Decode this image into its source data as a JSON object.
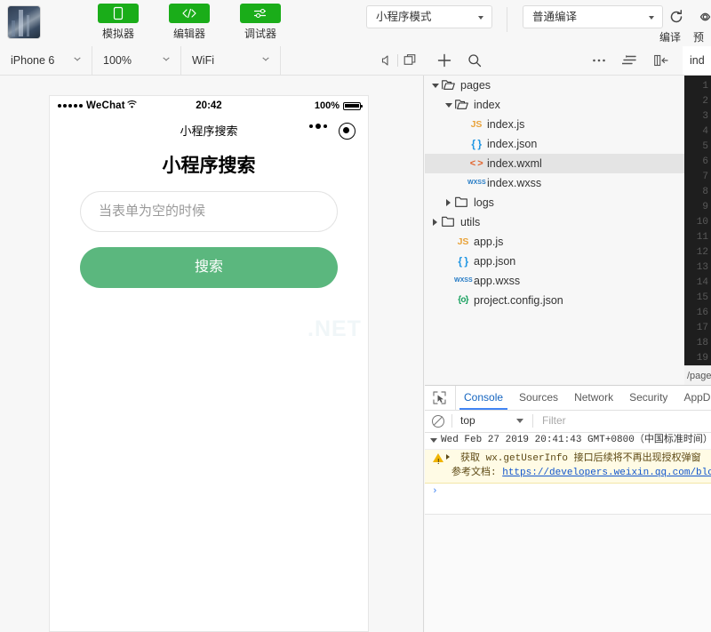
{
  "toolbar": {
    "avatar_name": "user-avatar",
    "mode_buttons": [
      {
        "label": "模拟器",
        "icon": "phone-icon"
      },
      {
        "label": "编辑器",
        "icon": "code-icon"
      },
      {
        "label": "调试器",
        "icon": "debug-icon"
      }
    ],
    "mode_select": {
      "value": "小程序模式"
    },
    "build_select": {
      "value": "普通编译"
    },
    "compile": {
      "label": "编译",
      "icon": "refresh-icon"
    },
    "preview": {
      "label": "预",
      "icon": "eye-icon"
    },
    "accent_green": "#1aad19"
  },
  "subbar": {
    "device": "iPhone 6",
    "zoom": "100%",
    "network": "WiFi",
    "icons": [
      "mute-icon",
      "multi-window-icon",
      "add-icon",
      "search-icon",
      "more-icon",
      "sort-icon",
      "panel-toggle-icon"
    ],
    "file_tab": "ind"
  },
  "simulator": {
    "status_bar": {
      "carrier": "WeChat",
      "time": "20:42",
      "battery_percent": "100%"
    },
    "nav_title": "小程序搜索",
    "page_title": "小程序搜索",
    "search_placeholder": "当表单为空的时候",
    "search_button": "搜索",
    "button_color": "#5bb77e",
    "watermark": ".NET"
  },
  "filetree": [
    {
      "label": "pages",
      "indent": 0,
      "type": "folder",
      "expanded": true,
      "selected": false
    },
    {
      "label": "index",
      "indent": 1,
      "type": "folder",
      "expanded": true,
      "selected": false
    },
    {
      "label": "index.js",
      "indent": 2,
      "type": "js",
      "expanded": null,
      "selected": false
    },
    {
      "label": "index.json",
      "indent": 2,
      "type": "json",
      "expanded": null,
      "selected": false
    },
    {
      "label": "index.wxml",
      "indent": 2,
      "type": "wxml",
      "expanded": null,
      "selected": true
    },
    {
      "label": "index.wxss",
      "indent": 2,
      "type": "wxss",
      "expanded": null,
      "selected": false
    },
    {
      "label": "logs",
      "indent": 1,
      "type": "folder",
      "expanded": false,
      "selected": false
    },
    {
      "label": "utils",
      "indent": 0,
      "type": "folder",
      "expanded": false,
      "selected": false
    },
    {
      "label": "app.js",
      "indent": 1,
      "type": "js",
      "expanded": null,
      "selected": false
    },
    {
      "label": "app.json",
      "indent": 1,
      "type": "json",
      "expanded": null,
      "selected": false
    },
    {
      "label": "app.wxss",
      "indent": 1,
      "type": "wxss",
      "expanded": null,
      "selected": false
    },
    {
      "label": "project.config.json",
      "indent": 1,
      "type": "proj",
      "expanded": null,
      "selected": false
    }
  ],
  "editor": {
    "line_numbers": [
      "1",
      "2",
      "3",
      "4",
      "5",
      "6",
      "7",
      "8",
      "9",
      "10",
      "11",
      "12",
      "13",
      "14",
      "15",
      "16",
      "17",
      "18",
      "19"
    ],
    "status_path": "/page"
  },
  "devtools": {
    "tabs": [
      {
        "label": "Console",
        "active": true
      },
      {
        "label": "Sources",
        "active": false
      },
      {
        "label": "Network",
        "active": false
      },
      {
        "label": "Security",
        "active": false
      },
      {
        "label": "AppDa",
        "active": false
      }
    ],
    "context": "top",
    "filter_placeholder": "Filter",
    "group_header": "Wed Feb 27 2019 20:41:43 GMT+0800（中国标准时间）",
    "warning_line1": "获取 wx.getUserInfo 接口后续将不再出现授权弹窗",
    "warning_line2_label": "参考文档:",
    "warning_line2_link": "https://developers.weixin.qq.com/blo",
    "prompt": "›"
  }
}
